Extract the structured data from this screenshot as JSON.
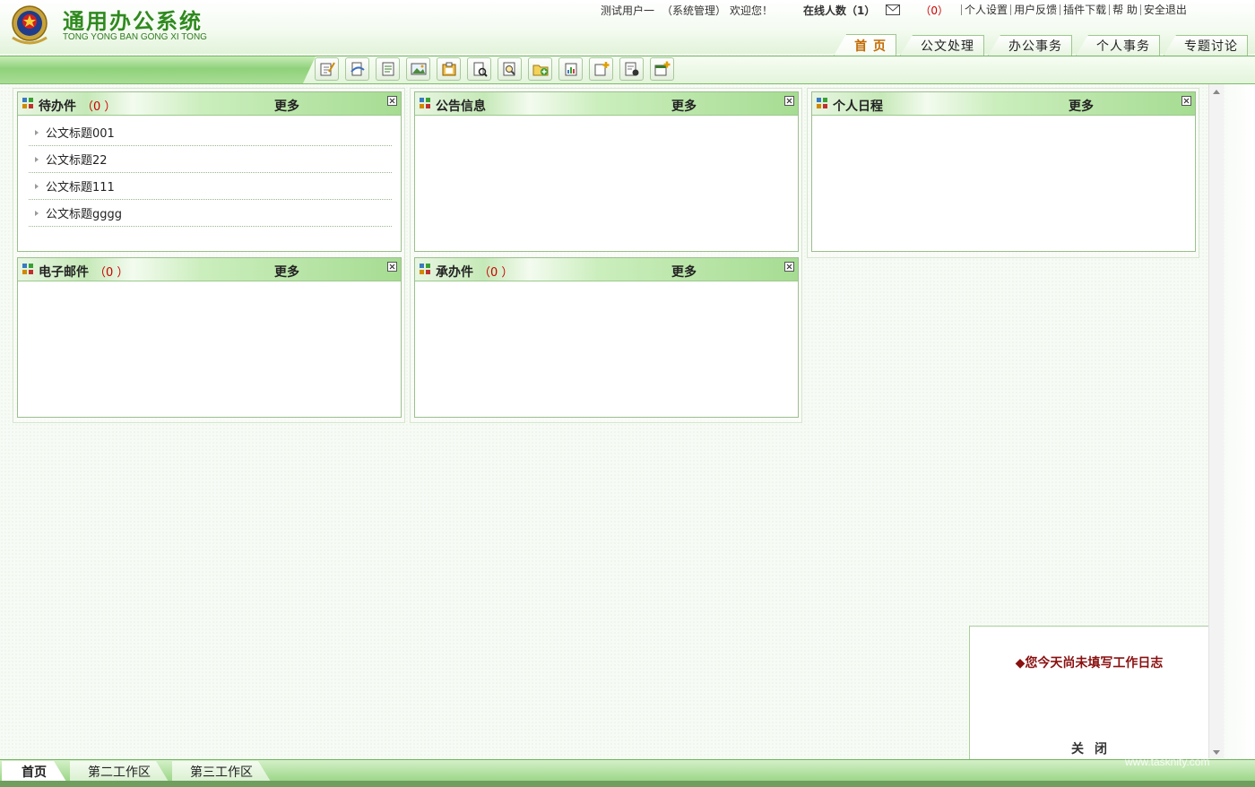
{
  "app": {
    "title": "通用办公系统",
    "subtitle": "TONG YONG BAN GONG XI TONG"
  },
  "userbar": {
    "user": "测试用户一",
    "role": "（系统管理）",
    "welcome": "欢迎您！",
    "online": "在线人数（1）",
    "mail_count": "（0）",
    "links": [
      "个人设置",
      "用户反馈",
      "插件下载",
      "帮  助",
      "安全退出"
    ]
  },
  "tabs": [
    {
      "label": "首 页",
      "active": true
    },
    {
      "label": "公文处理",
      "active": false
    },
    {
      "label": "办公事务",
      "active": false
    },
    {
      "label": "个人事务",
      "active": false
    },
    {
      "label": "专题讨论",
      "active": false
    }
  ],
  "toolbar": {
    "icons": [
      "edit-icon",
      "sign-icon",
      "document-icon",
      "image-icon",
      "clipboard-icon",
      "view-document-icon",
      "search-document-icon",
      "folder-add-icon",
      "report-icon",
      "new-document-icon",
      "document-view-icon",
      "add-window-icon"
    ]
  },
  "panels": {
    "pending": {
      "title": "待办件",
      "count": "（0 ）",
      "more": "更多",
      "items": [
        "公文标题001",
        "公文标题22",
        "公文标题111",
        "公文标题gggg"
      ]
    },
    "notice": {
      "title": "公告信息",
      "more": "更多"
    },
    "schedule": {
      "title": "个人日程",
      "more": "更多"
    },
    "email": {
      "title": "电子邮件",
      "count": "（0 ）",
      "more": "更多"
    },
    "undertake": {
      "title": "承办件",
      "count": "（0 ）",
      "more": "更多"
    }
  },
  "popup": {
    "message": "◆您今天尚未填写工作日志",
    "close": "关闭"
  },
  "bottom_tabs": [
    {
      "label": "首页",
      "active": true
    },
    {
      "label": "第二工作区",
      "active": false
    },
    {
      "label": "第三工作区",
      "active": false
    }
  ],
  "watermark": "www.tasknity.com",
  "colors": {
    "brand_green": "#2f8a1e",
    "toolbar_green": "#8fd17a",
    "active_tab": "#c26a00",
    "count_red": "#cc0000",
    "popup_red": "#8a0f0f"
  }
}
